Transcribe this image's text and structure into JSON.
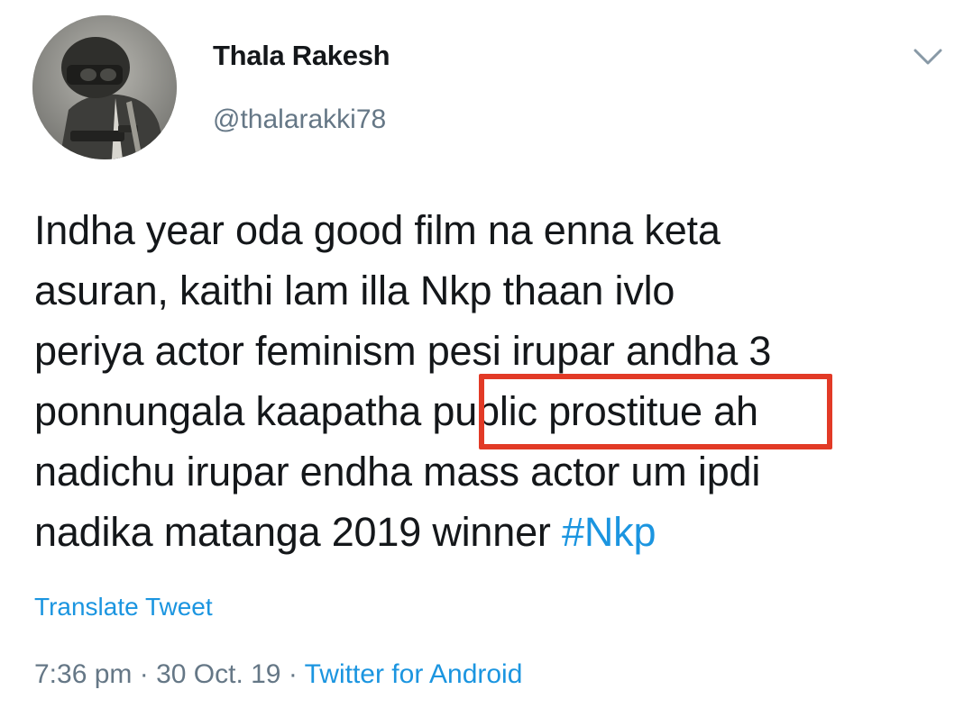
{
  "user": {
    "display_name": "Thala Rakesh",
    "handle": "@thalarakki78",
    "avatar_icon": "user-avatar"
  },
  "menu": {
    "icon": "chevron-down-icon"
  },
  "tweet": {
    "lines": [
      "Indha year oda good film na enna keta",
      "asuran, kaithi lam illa Nkp thaan ivlo",
      "periya actor feminism pesi irupar andha 3",
      "ponnungala kaapatha public prostitue ah",
      "nadichu irupar endha mass actor um ipdi",
      "nadika matanga 2019 winner "
    ],
    "hashtag": "#Nkp",
    "highlighted_phrase": "public prostitue"
  },
  "translate_label": "Translate Tweet",
  "meta": {
    "time": "7:36 pm",
    "separator": " · ",
    "date": "30 Oct. 19",
    "source": "Twitter for Android"
  },
  "colors": {
    "link": "#1b95e0",
    "secondary_text": "#657786",
    "highlight_border": "#e23a26"
  }
}
